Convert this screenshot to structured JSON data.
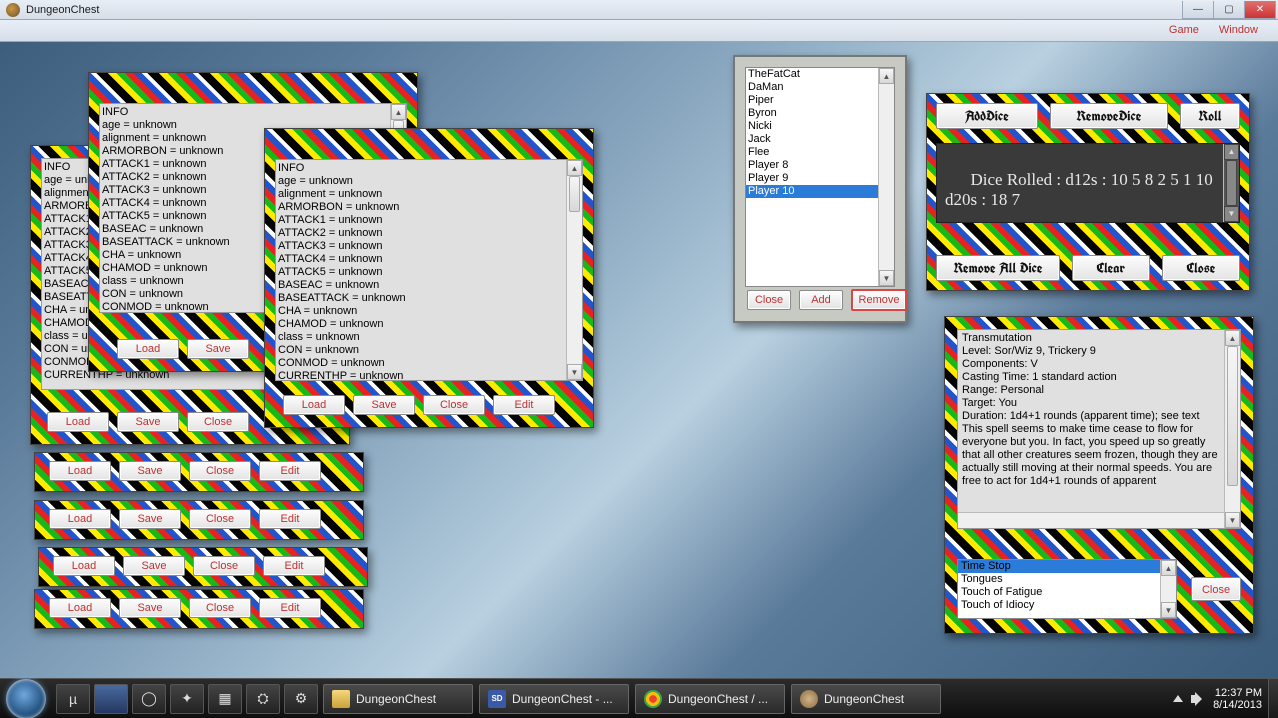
{
  "window": {
    "title": "DungeonChest",
    "min": "—",
    "max": "▢",
    "close": "✕"
  },
  "menu": {
    "game": "Game",
    "window": "Window"
  },
  "info_lines": "INFO\nage = unknown\nalignment = unknown\nARMORBON = unknown\nATTACK1 = unknown\nATTACK2 = unknown\nATTACK3 = unknown\nATTACK4 = unknown\nATTACK5 = unknown\nBASEAC = unknown\nBASEATTACK = unknown\nCHA = unknown\nCHAMOD = unknown\nclass = unknown\nCON = unknown\nCONMOD = unknown\nCURRENTHP = unknown",
  "btn": {
    "load": "Load",
    "save": "Save",
    "close": "Close",
    "edit": "Edit",
    "add": "Add",
    "remove": "Remove",
    "clear": "Clear"
  },
  "players": {
    "items": [
      "TheFatCat",
      "DaMan",
      "Piper",
      "Byron",
      "Nicki",
      "Jack",
      "Flee",
      "Player 8",
      "Player 9",
      "Player 10"
    ],
    "selected_index": 9
  },
  "dice": {
    "add": "AddDice",
    "remove": "RemoveDice",
    "roll": "Roll",
    "output": "Dice Rolled : d12s : 10 5 8 2 5 1 10 d20s : 18 7",
    "remove_all": "Remove All Dice",
    "clear": "Clear",
    "close": "Close"
  },
  "spell": {
    "text": "Transmutation\nLevel: Sor/Wiz 9, Trickery 9\nComponents: V\nCasting Time: 1 standard action\nRange: Personal\nTarget: You\nDuration: 1d4+1 rounds (apparent time); see text\nThis spell seems to make time cease to flow for everyone but you. In fact, you speed up so greatly that all other creatures seem frozen, though they are actually still moving at their normal speeds. You are free to act for 1d4+1 rounds of apparent",
    "list": [
      "Time Stop",
      "Tongues",
      "Touch of Fatigue",
      "Touch of Idiocy"
    ],
    "selected_index": 0,
    "close": "Close"
  },
  "taskbar": {
    "tasks": [
      {
        "icon": "folder",
        "label": "DungeonChest"
      },
      {
        "icon": "sd",
        "label": "DungeonChest - ..."
      },
      {
        "icon": "chrome",
        "label": "DungeonChest / ..."
      },
      {
        "icon": "dc",
        "label": "DungeonChest"
      }
    ],
    "time": "12:37 PM",
    "date": "8/14/2013"
  }
}
